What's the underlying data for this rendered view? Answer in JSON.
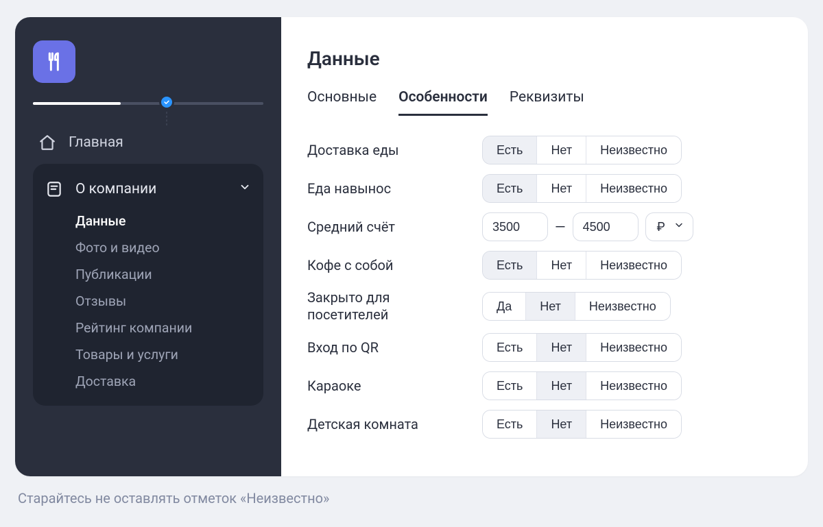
{
  "sidebar": {
    "progress": {
      "fill_percent": 38,
      "badge_percent": 58
    },
    "home_label": "Главная",
    "group": {
      "label": "О компании",
      "items": [
        {
          "label": "Данные",
          "active": true
        },
        {
          "label": "Фото и видео",
          "active": false
        },
        {
          "label": "Публикации",
          "active": false
        },
        {
          "label": "Отзывы",
          "active": false
        },
        {
          "label": "Рейтинг компании",
          "active": false
        },
        {
          "label": "Товары и услуги",
          "active": false
        },
        {
          "label": "Доставка",
          "active": false
        }
      ]
    }
  },
  "main": {
    "title": "Данные",
    "tabs": [
      {
        "label": "Основные",
        "active": false
      },
      {
        "label": "Особенности",
        "active": true
      },
      {
        "label": "Реквизиты",
        "active": false
      }
    ],
    "option_labels": {
      "yes": "Есть",
      "yes_alt": "Да",
      "no": "Нет",
      "unknown": "Неизвестно"
    },
    "rows": [
      {
        "label": "Доставка еды",
        "type": "tri",
        "yes_variant": "yes",
        "selected": "yes"
      },
      {
        "label": "Еда навынос",
        "type": "tri",
        "yes_variant": "yes",
        "selected": "yes"
      },
      {
        "label": "Средний счёт",
        "type": "range",
        "from": "3500",
        "to": "4500",
        "currency": "₽"
      },
      {
        "label": "Кофе с собой",
        "type": "tri",
        "yes_variant": "yes",
        "selected": "yes"
      },
      {
        "label": "Закрыто для посетителей",
        "type": "tri",
        "yes_variant": "yes_alt",
        "selected": "no"
      },
      {
        "label": "Вход по QR",
        "type": "tri",
        "yes_variant": "yes",
        "selected": "no"
      },
      {
        "label": "Караоке",
        "type": "tri",
        "yes_variant": "yes",
        "selected": "no"
      },
      {
        "label": "Детская комната",
        "type": "tri",
        "yes_variant": "yes",
        "selected": "no"
      }
    ],
    "dash": "—"
  },
  "footnote": "Старайтесь не оставлять отметок «Неизвестно»"
}
